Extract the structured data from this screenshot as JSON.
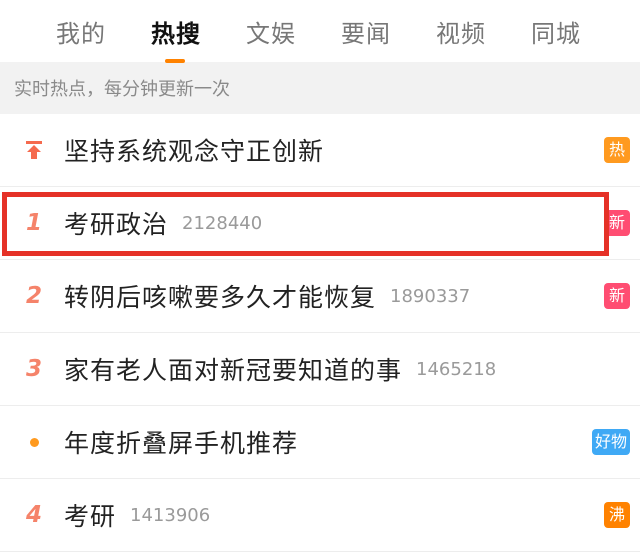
{
  "tabs": [
    {
      "label": "我的"
    },
    {
      "label": "热搜"
    },
    {
      "label": "文娱"
    },
    {
      "label": "要闻"
    },
    {
      "label": "视频"
    },
    {
      "label": "同城"
    }
  ],
  "active_tab": "热搜",
  "subheader": "实时热点，每分钟更新一次",
  "list": [
    {
      "rank": "",
      "rank_icon": "pin-top-icon",
      "title": "坚持系统观念守正创新",
      "count": "",
      "badge": "热",
      "badge_color": "#ff9a1f"
    },
    {
      "rank": "1",
      "title": "考研政治",
      "count": "2128440",
      "badge": "新",
      "badge_color": "#ff4d72"
    },
    {
      "rank": "2",
      "title": "转阴后咳嗽要多久才能恢复",
      "count": "1890337",
      "badge": "新",
      "badge_color": "#ff4d72"
    },
    {
      "rank": "3",
      "title": "家有老人面对新冠要知道的事",
      "count": "1465218",
      "badge": "",
      "badge_color": ""
    },
    {
      "rank": "",
      "rank_icon": "dot-icon",
      "title": "年度折叠屏手机推荐",
      "count": "",
      "badge": "好物",
      "badge_color": "#3fa9f5"
    },
    {
      "rank": "4",
      "title": "考研",
      "count": "1413906",
      "badge": "沸",
      "badge_color": "#ff8200"
    }
  ],
  "colors": {
    "accent": "#ff8200",
    "highlight_box": "#e53127",
    "rank": "#f5836a"
  }
}
